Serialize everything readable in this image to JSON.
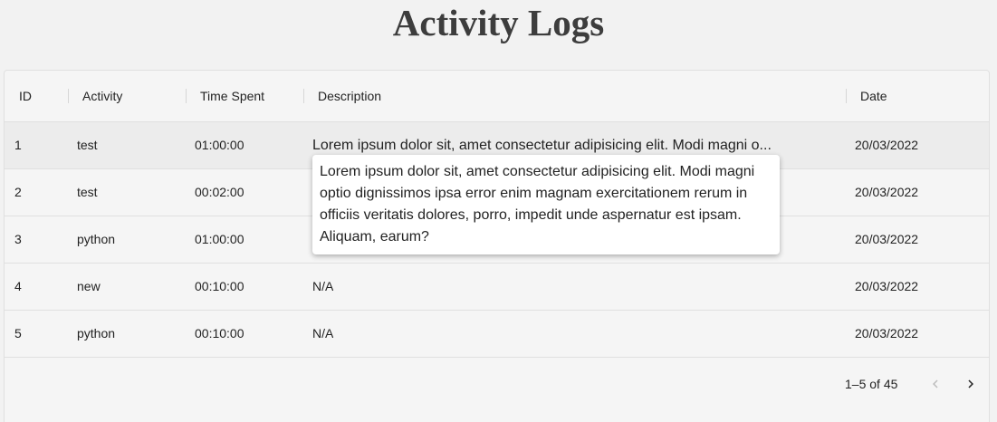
{
  "page": {
    "title": "Activity Logs"
  },
  "table": {
    "columns": [
      {
        "label": "ID"
      },
      {
        "label": "Activity"
      },
      {
        "label": "Time Spent"
      },
      {
        "label": "Description"
      },
      {
        "label": "Date"
      }
    ],
    "rows": [
      {
        "id": "1",
        "activity": "test",
        "time": "01:00:00",
        "description": "Lorem ipsum dolor sit, amet consectetur adipisicing elit. Modi magni o...",
        "date": "20/03/2022"
      },
      {
        "id": "2",
        "activity": "test",
        "time": "00:02:00",
        "description": "",
        "date": "20/03/2022"
      },
      {
        "id": "3",
        "activity": "python",
        "time": "01:00:00",
        "description": "",
        "date": "20/03/2022"
      },
      {
        "id": "4",
        "activity": "new",
        "time": "00:10:00",
        "description": "N/A",
        "date": "20/03/2022"
      },
      {
        "id": "5",
        "activity": "python",
        "time": "00:10:00",
        "description": "N/A",
        "date": "20/03/2022"
      }
    ]
  },
  "tooltip": {
    "text": "Lorem ipsum dolor sit, amet consectetur adipisicing elit. Modi magni optio dignissimos ipsa error enim magnam exercitationem rerum in officiis veritatis dolores, porro, impedit unde aspernatur est ipsam. Aliquam, earum?"
  },
  "pagination": {
    "range_label": "1–5 of 45",
    "prev_icon": "chevron-left-icon",
    "next_icon": "chevron-right-icon"
  },
  "colors": {
    "background": "#f2f2f2",
    "hover_row": "#ececec",
    "title": "#3d3d3d"
  }
}
